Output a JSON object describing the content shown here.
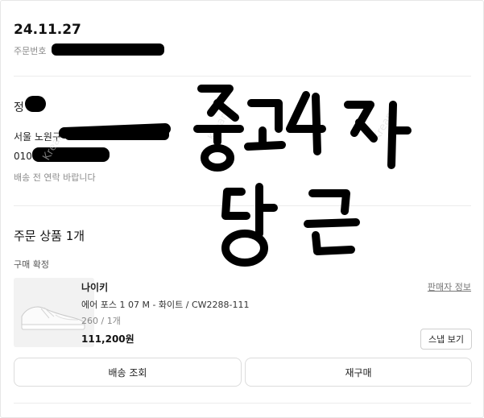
{
  "order": {
    "date": "24.11.27",
    "number_label": "주문번호"
  },
  "shipping": {
    "name_visible": "정",
    "address_visible": "서울 노원구",
    "phone_visible": "010",
    "memo": "배송 전 연락 바랍니다"
  },
  "items_section": {
    "title": "주문 상품 1개",
    "status": "구매 확정"
  },
  "product": {
    "brand": "나이키",
    "name": "에어 포스 1 07 M - 화이트 / CW2288-111",
    "option": "260 / 1개",
    "price": "111,200원",
    "seller_info_link": "판매자 정보",
    "snap_button": "스냅 보기"
  },
  "actions": {
    "track_shipping": "배송 조회",
    "reorder": "재구매"
  },
  "handwriting": {
    "line1": "중고4자",
    "line2": "당근"
  },
  "watermark": "Kream"
}
